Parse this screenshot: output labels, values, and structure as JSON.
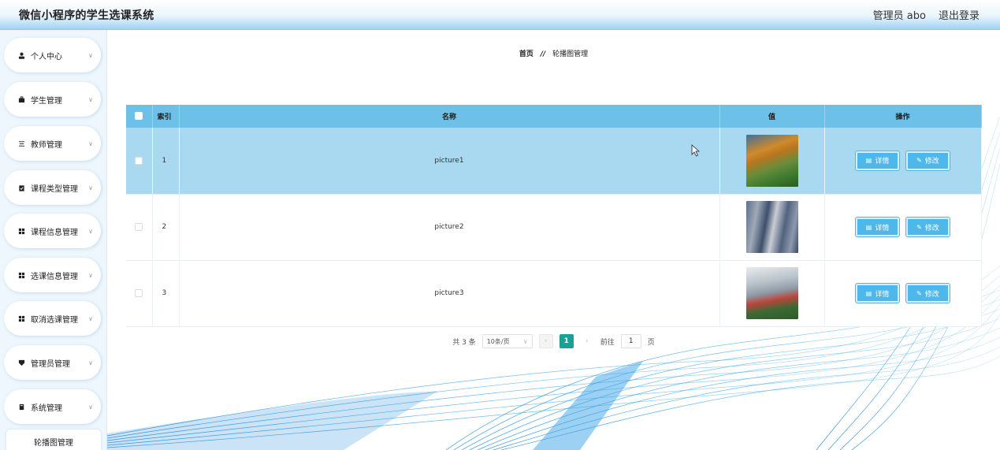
{
  "header": {
    "app_title": "微信小程序的学生选课系统",
    "user_label": "管理员 abo",
    "logout_label": "退出登录"
  },
  "sidebar": {
    "items": [
      {
        "label": "个人中心",
        "icon": "user-icon"
      },
      {
        "label": "学生管理",
        "icon": "briefcase-icon"
      },
      {
        "label": "教师管理",
        "icon": "list-icon"
      },
      {
        "label": "课程类型管理",
        "icon": "clipboard-icon"
      },
      {
        "label": "课程信息管理",
        "icon": "grid-icon"
      },
      {
        "label": "选课信息管理",
        "icon": "grid-icon"
      },
      {
        "label": "取消选课管理",
        "icon": "grid-icon"
      },
      {
        "label": "管理员管理",
        "icon": "shield-icon"
      },
      {
        "label": "系统管理",
        "icon": "book-icon"
      }
    ],
    "sub_item": "轮播图管理"
  },
  "breadcrumb": {
    "home": "首页",
    "separator": "//",
    "current": "轮播图管理"
  },
  "table": {
    "headers": {
      "index": "索引",
      "name": "名称",
      "value": "值",
      "actions": "操作"
    },
    "rows": [
      {
        "index": "1",
        "name": "picture1",
        "selected": true
      },
      {
        "index": "2",
        "name": "picture2",
        "selected": false
      },
      {
        "index": "3",
        "name": "picture3",
        "selected": false
      }
    ],
    "detail_label": "详情",
    "edit_label": "修改"
  },
  "pagination": {
    "total": "共 3 条",
    "page_size": "10条/页",
    "current_page": "1",
    "goto_label": "前往",
    "goto_value": "1",
    "page_unit": "页"
  },
  "colors": {
    "accent": "#6dc0e7",
    "button": "#4fb8ea",
    "active_page": "#1aa094"
  }
}
